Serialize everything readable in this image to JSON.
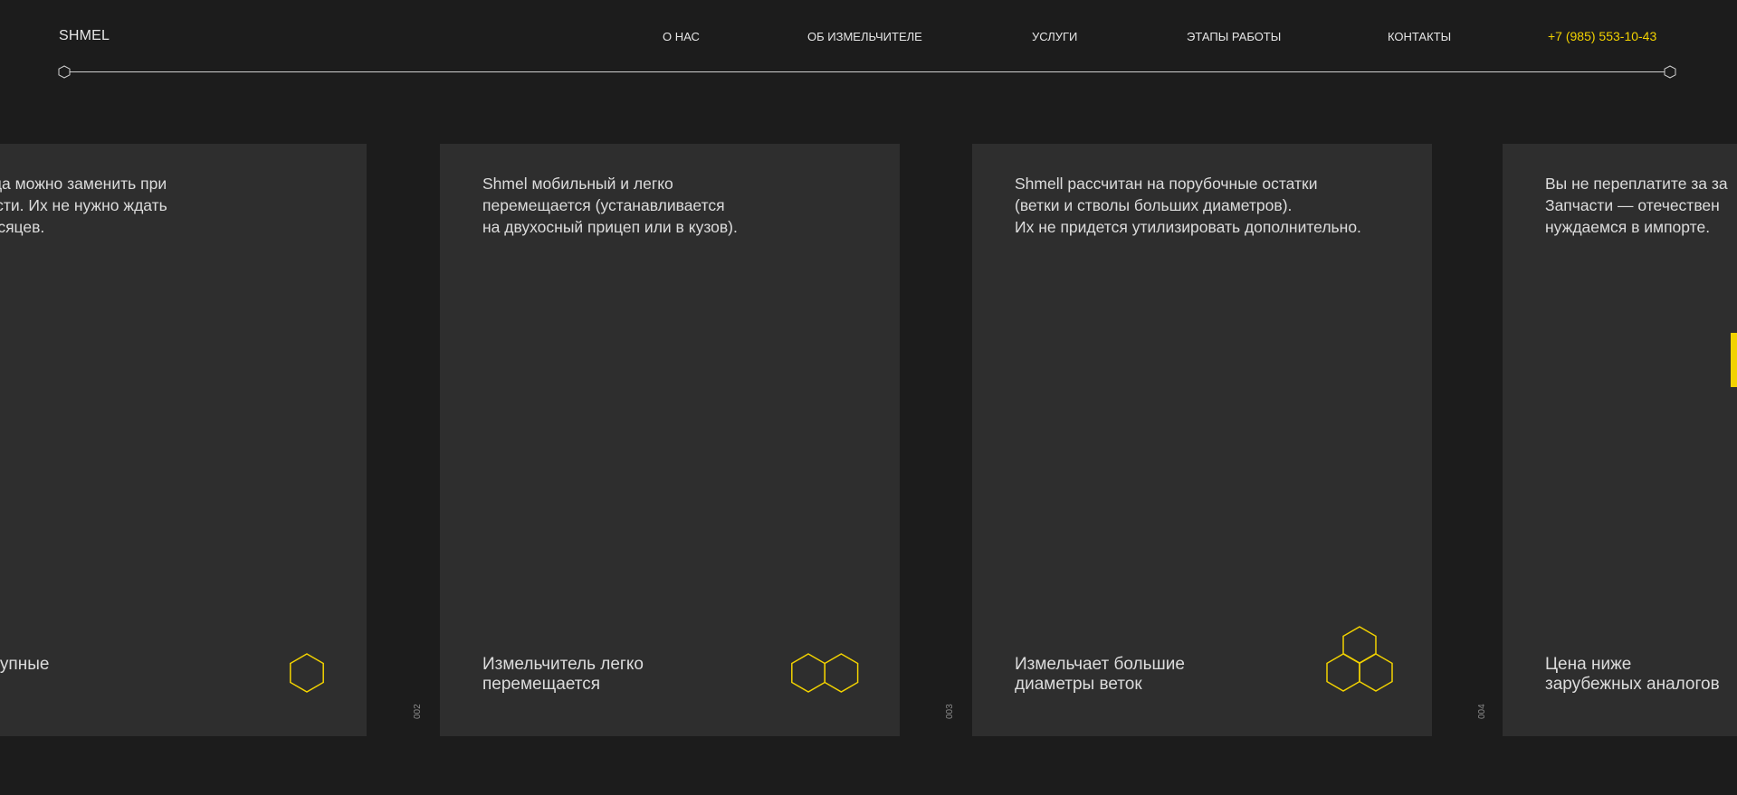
{
  "header": {
    "logo": "SHMEL",
    "nav": [
      {
        "label": "О НАС"
      },
      {
        "label": "ОБ ИЗМЕЛЬЧИТЕЛЕ"
      },
      {
        "label": "УСЛУГИ"
      },
      {
        "label": "ЭТАПЫ РАБОТЫ"
      },
      {
        "label": "КОНТАКТЫ"
      }
    ],
    "phone": "+7 (985) 553-10-43"
  },
  "colors": {
    "background": "#1c1c1c",
    "card": "#2e2e2e",
    "accent": "#f2d200"
  },
  "cards": [
    {
      "description": "и всегда можно заменить при\nодимости. Их не нужно ждать\nько месяцев.",
      "title": "а доступные\nсти",
      "icon": "single-hexagon-icon"
    },
    {
      "number": "002",
      "description": "Shmel мобильный и легко\nперемещается (устанавливается\nна двухосный прицеп или в кузов).",
      "title": "Измельчитель легко\nперемещается",
      "icon": "double-hexagon-icon"
    },
    {
      "number": "003",
      "description": "Shmell рассчитан на порубочные остатки\n(ветки и стволы больших диаметров).\nИх не придется утилизировать дополнительно.",
      "title": "Измельчает большие\nдиаметры веток",
      "icon": "triple-hexagon-icon"
    },
    {
      "number": "004",
      "description": "Вы не переплатите за за\nЗапчасти — отечествен\nнуждаемся в импорте.",
      "title": "Цена ниже\nзарубежных аналогов",
      "icon": ""
    }
  ]
}
